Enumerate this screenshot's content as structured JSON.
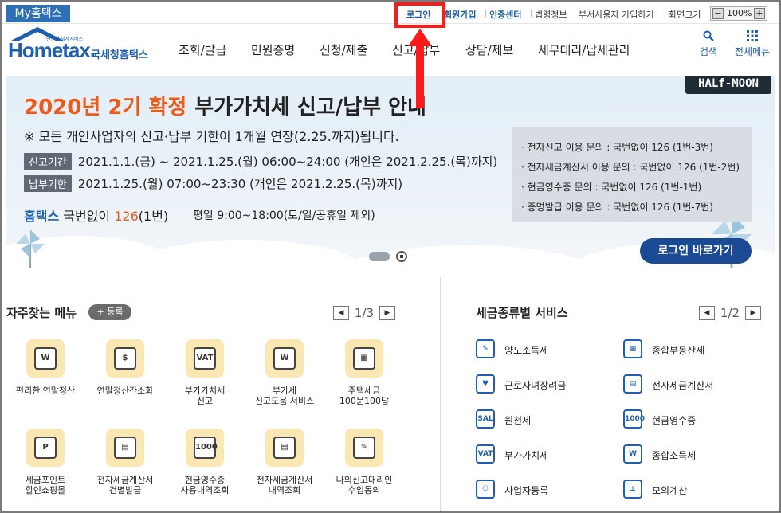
{
  "topbar": {
    "my_tab": "My홈택스",
    "login": "로그인",
    "signup": "회원가입",
    "cert": "인증센터",
    "law": "법령정보",
    "dept": "부서사용자 가입하기",
    "zoom_label": "화면크기",
    "zoom_value": "100%",
    "zoom_minus": "−",
    "zoom_plus": "+"
  },
  "header": {
    "logo_small": "안전한 납세서비스",
    "logo_main": "Hometax.",
    "logo_kr": "국세청홈택스",
    "nav": [
      "조회/발급",
      "민원증명",
      "신청/제출",
      "신고/납부",
      "상담/제보",
      "세무대리/납세관리"
    ],
    "search_label": "검색",
    "search_icon": "search-icon",
    "menu_label": "전체메뉴",
    "menu_icon": "grid-icon"
  },
  "banner": {
    "badge": "HALf-MOON",
    "title_highlight": "2020년 2기 확정",
    "title_rest": "부가가치세 신고/납부 안내",
    "notice": "※ 모든 개인사업자의 신고·납부 기한이 1개월 연장(2.25.까지)됩니다.",
    "rows": [
      {
        "tag": "신고기간",
        "text": "2021.1.1.(금) ~ 2021.1.25.(월) 06:00~24:00 (개인은 2021.2.25.(목)까지)"
      },
      {
        "tag": "납부기한",
        "text": "2021.1.25.(월) 07:00~23:30 (개인은 2021.2.25.(목)까지)"
      }
    ],
    "hotline_brand": "홈택스",
    "hotline_text": "국번없이",
    "hotline_num": "126",
    "hotline_suffix": "(1번)",
    "hours": "평일 9:00~18:00(토/일/공휴일 제외)",
    "info": [
      "· 전자신고 이용 문의 : 국번없이 126 (1번-3번)",
      "· 전자세금계산서 이용 문의 : 국번없이 126 (1번-2번)",
      "· 현금영수증 문의 : 국번없이 126 (1번-1번)",
      "· 증명발급 이용 문의 : 국번없이 126 (1번-7번)"
    ],
    "login_button": "로그인 바로가기"
  },
  "favorites": {
    "title": "자주찾는 메뉴",
    "add": "+ 등록",
    "page": "1/3",
    "items": [
      {
        "label": "편리한 연말정산",
        "glyph": "W"
      },
      {
        "label": "연말정산간소화",
        "glyph": "$"
      },
      {
        "label": "부가가치세\n신고",
        "glyph": "VAT"
      },
      {
        "label": "부가세\n신고도움 서비스",
        "glyph": "W"
      },
      {
        "label": "주택세금\n100문100답",
        "glyph": "▦"
      },
      {
        "label": "세금포인트\n할인쇼핑몰",
        "glyph": "P"
      },
      {
        "label": "전자세금계산서\n건별발급",
        "glyph": "▤"
      },
      {
        "label": "현금영수증\n사용내역조회",
        "glyph": "1000"
      },
      {
        "label": "전자세금계산서\n내역조회",
        "glyph": "▤"
      },
      {
        "label": "나의신고대리인\n수임동의",
        "glyph": "✎"
      }
    ]
  },
  "services": {
    "title": "세금종류별 서비스",
    "page": "1/2",
    "items": [
      {
        "label": "양도소득세",
        "glyph": "✎"
      },
      {
        "label": "종합부동산세",
        "glyph": "▦"
      },
      {
        "label": "근로자녀장려금",
        "glyph": "♥"
      },
      {
        "label": "전자세금계산서",
        "glyph": "▤"
      },
      {
        "label": "원천세",
        "glyph": "SAL"
      },
      {
        "label": "현금영수증",
        "glyph": "1000"
      },
      {
        "label": "부가가치세",
        "glyph": "VAT"
      },
      {
        "label": "종합소득세",
        "glyph": "W"
      },
      {
        "label": "사업자등록",
        "glyph": "⚇"
      },
      {
        "label": "모의계산",
        "glyph": "±"
      }
    ]
  },
  "colors": {
    "brand": "#1f5fae",
    "accent": "#ef5a18",
    "highlight_box": "#ff1a1a",
    "login_btn": "#1a4a94"
  }
}
